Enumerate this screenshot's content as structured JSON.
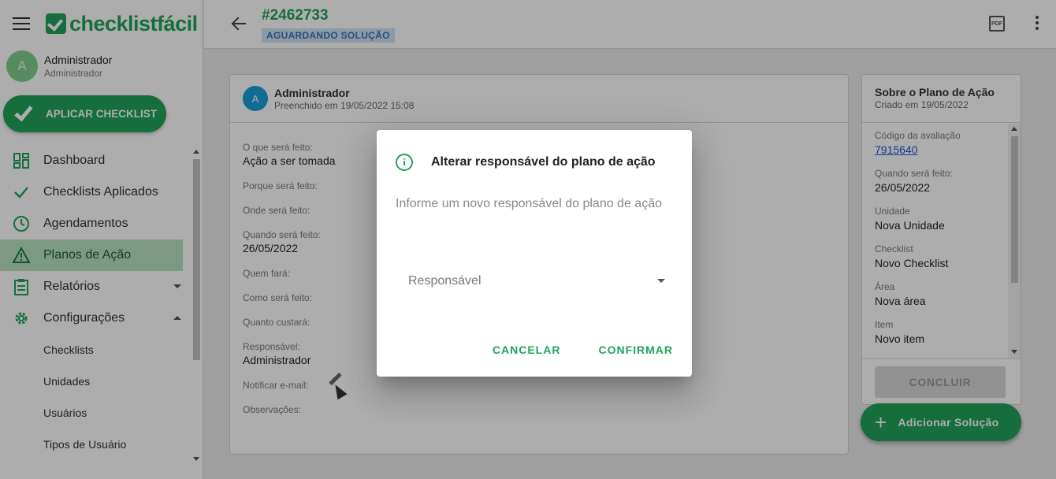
{
  "brand": {
    "name": "checklistfácil"
  },
  "user": {
    "initial": "A",
    "name": "Administrador",
    "role": "Administrador"
  },
  "sidebar": {
    "apply_label": "APLICAR CHECKLIST",
    "items": [
      {
        "label": "Dashboard",
        "icon": "dashboard-icon"
      },
      {
        "label": "Checklists Aplicados",
        "icon": "check-icon"
      },
      {
        "label": "Agendamentos",
        "icon": "clock-icon"
      },
      {
        "label": "Planos de Ação",
        "icon": "warning-icon"
      },
      {
        "label": "Relatórios",
        "icon": "clipboard-icon"
      },
      {
        "label": "Configurações",
        "icon": "gear-icon"
      }
    ],
    "sub_items": [
      "Checklists",
      "Unidades",
      "Usuários",
      "Tipos de Usuário"
    ]
  },
  "header": {
    "plan_id": "#2462733",
    "status": "AGUARDANDO SOLUÇÃO",
    "pdf_icon_text": "PDF"
  },
  "card": {
    "author_initial": "A",
    "author": "Administrador",
    "filled_at": "Preenchido em 19/05/2022 15:08",
    "fields": [
      {
        "label": "O que será feito:",
        "value": "Ação a ser tomada"
      },
      {
        "label": "Porque será feito:",
        "value": ""
      },
      {
        "label": "Onde será feito:",
        "value": ""
      },
      {
        "label": "Quando será feito:",
        "value": "26/05/2022"
      },
      {
        "label": "Quem fará:",
        "value": ""
      },
      {
        "label": "Como será feito:",
        "value": ""
      },
      {
        "label": "Quanto custará:",
        "value": ""
      },
      {
        "label": "Responsável:",
        "value": "Administrador"
      },
      {
        "label": "Notificar e-mail:",
        "value": ""
      },
      {
        "label": "Observações:",
        "value": ""
      }
    ]
  },
  "panel": {
    "title": "Sobre o Plano de Ação",
    "created": "Criado em 19/05/2022",
    "fields": [
      {
        "label": "Código da avaliação",
        "value": "7915640"
      },
      {
        "label": "Quando será feito:",
        "value": "26/05/2022"
      },
      {
        "label": "Unidade",
        "value": "Nova Unidade"
      },
      {
        "label": "Checklist",
        "value": "Novo Checklist"
      },
      {
        "label": "Área",
        "value": "Nova área"
      },
      {
        "label": "Item",
        "value": "Novo item"
      }
    ],
    "conclude_label": "CONCLUIR",
    "add_solution_label": "Adicionar Solução"
  },
  "dialog": {
    "title": "Alterar responsável do plano de ação",
    "text": "Informe um novo responsável do plano de ação",
    "select_placeholder": "Responsável",
    "cancel_label": "CANCELAR",
    "confirm_label": "CONFIRMAR"
  },
  "colors": {
    "brand": "#21a35a",
    "link": "#1a53d6",
    "badge_bg": "#cfe3f7",
    "badge_text": "#3a74b5"
  }
}
